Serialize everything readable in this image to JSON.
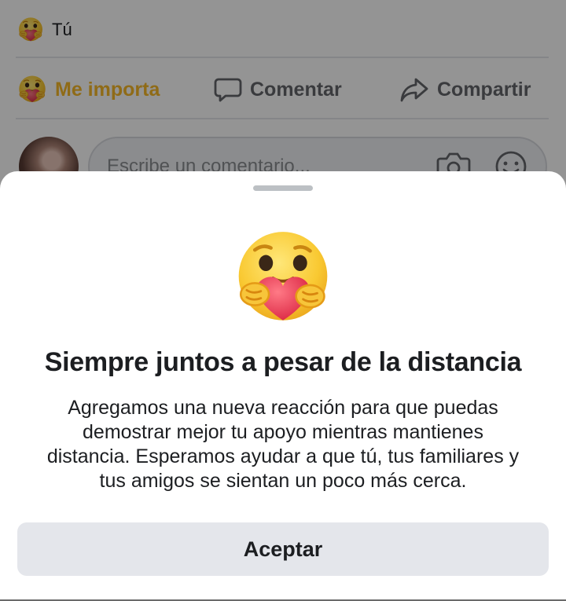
{
  "post": {
    "reactor_label": "Tú",
    "actions": {
      "care_label": "Me importa",
      "comment_label": "Comentar",
      "share_label": "Compartir"
    },
    "composer": {
      "placeholder": "Escribe un comentario...",
      "icons": [
        "camera-icon",
        "smiley-icon"
      ]
    }
  },
  "sheet": {
    "emoji": "care-reaction-icon",
    "title": "Siempre juntos a pesar de la distancia",
    "body_lines": [
      "Agregamos una nueva reacción para que puedas",
      "demostrar mejor tu apoyo mientras mantienes",
      "distancia. Esperamos ayudar a que tú, tus familiares y",
      "tus amigos se sientan un poco más cerca."
    ],
    "accept_label": "Aceptar"
  },
  "colors": {
    "care_accent": "#f7b928",
    "overlay": "rgba(0,0,0,0.42)",
    "button_bg": "#e4e6eb",
    "text_primary": "#1c1e21",
    "text_secondary": "#65676b"
  }
}
